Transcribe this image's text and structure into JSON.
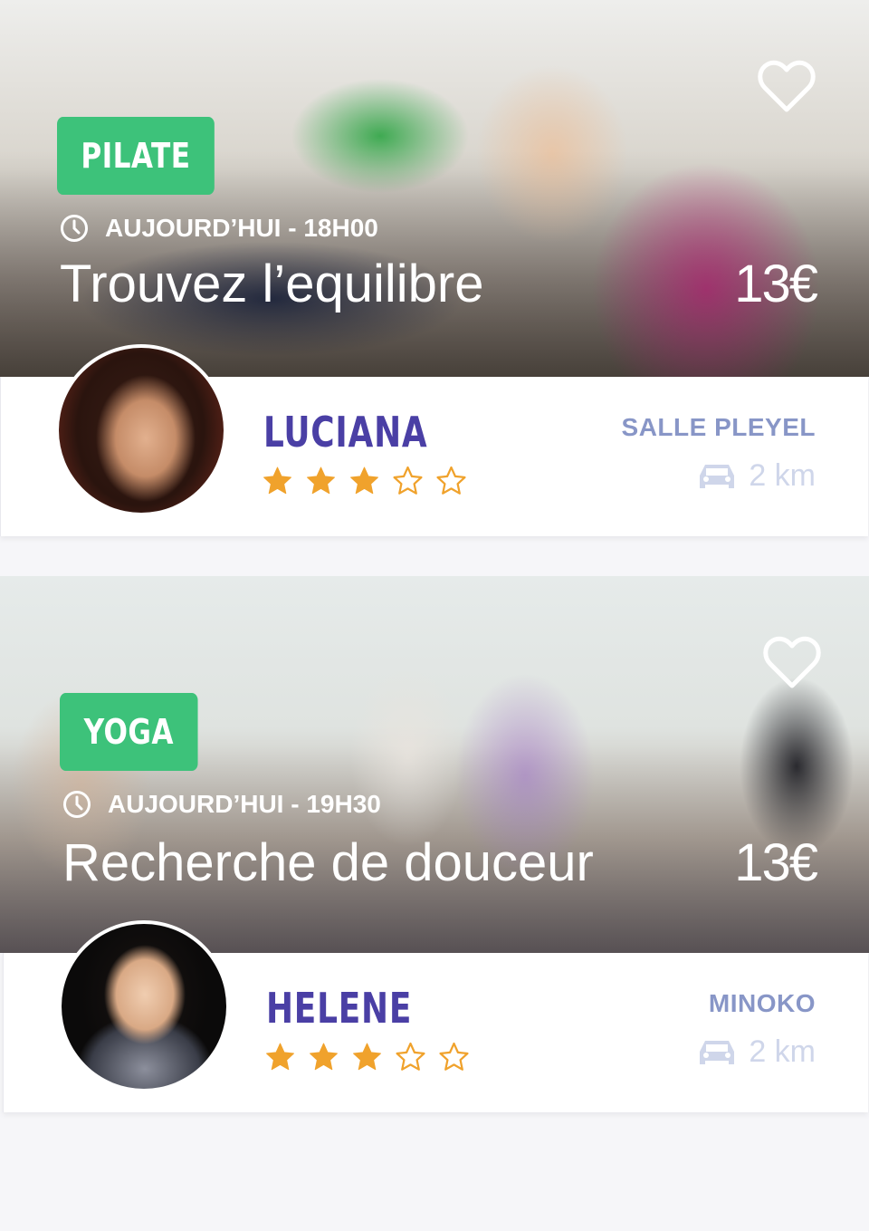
{
  "colors": {
    "tag_bg": "#3dc27a",
    "name": "#4a3fa5",
    "venue": "#8896c7",
    "distance": "#cfd6ea",
    "star": "#f0a22c"
  },
  "cards": [
    {
      "category": "PILATE",
      "when": "AUJOURD’HUI - 18H00",
      "title": "Trouvez l’equilibre",
      "price": "13€",
      "instructor": "LUCIANA",
      "rating": 3,
      "rating_max": 5,
      "venue": "SALLE PLEYEL",
      "distance": "2 km",
      "icons": {
        "favorite": "heart-icon",
        "time": "clock-icon",
        "transport": "car-icon"
      }
    },
    {
      "category": "YOGA",
      "when": "AUJOURD’HUI - 19H30",
      "title": "Recherche de douceur",
      "price": "13€",
      "instructor": "HELENE",
      "rating": 3,
      "rating_max": 5,
      "venue": "MINOKO",
      "distance": "2 km",
      "icons": {
        "favorite": "heart-icon",
        "time": "clock-icon",
        "transport": "car-icon"
      }
    }
  ]
}
